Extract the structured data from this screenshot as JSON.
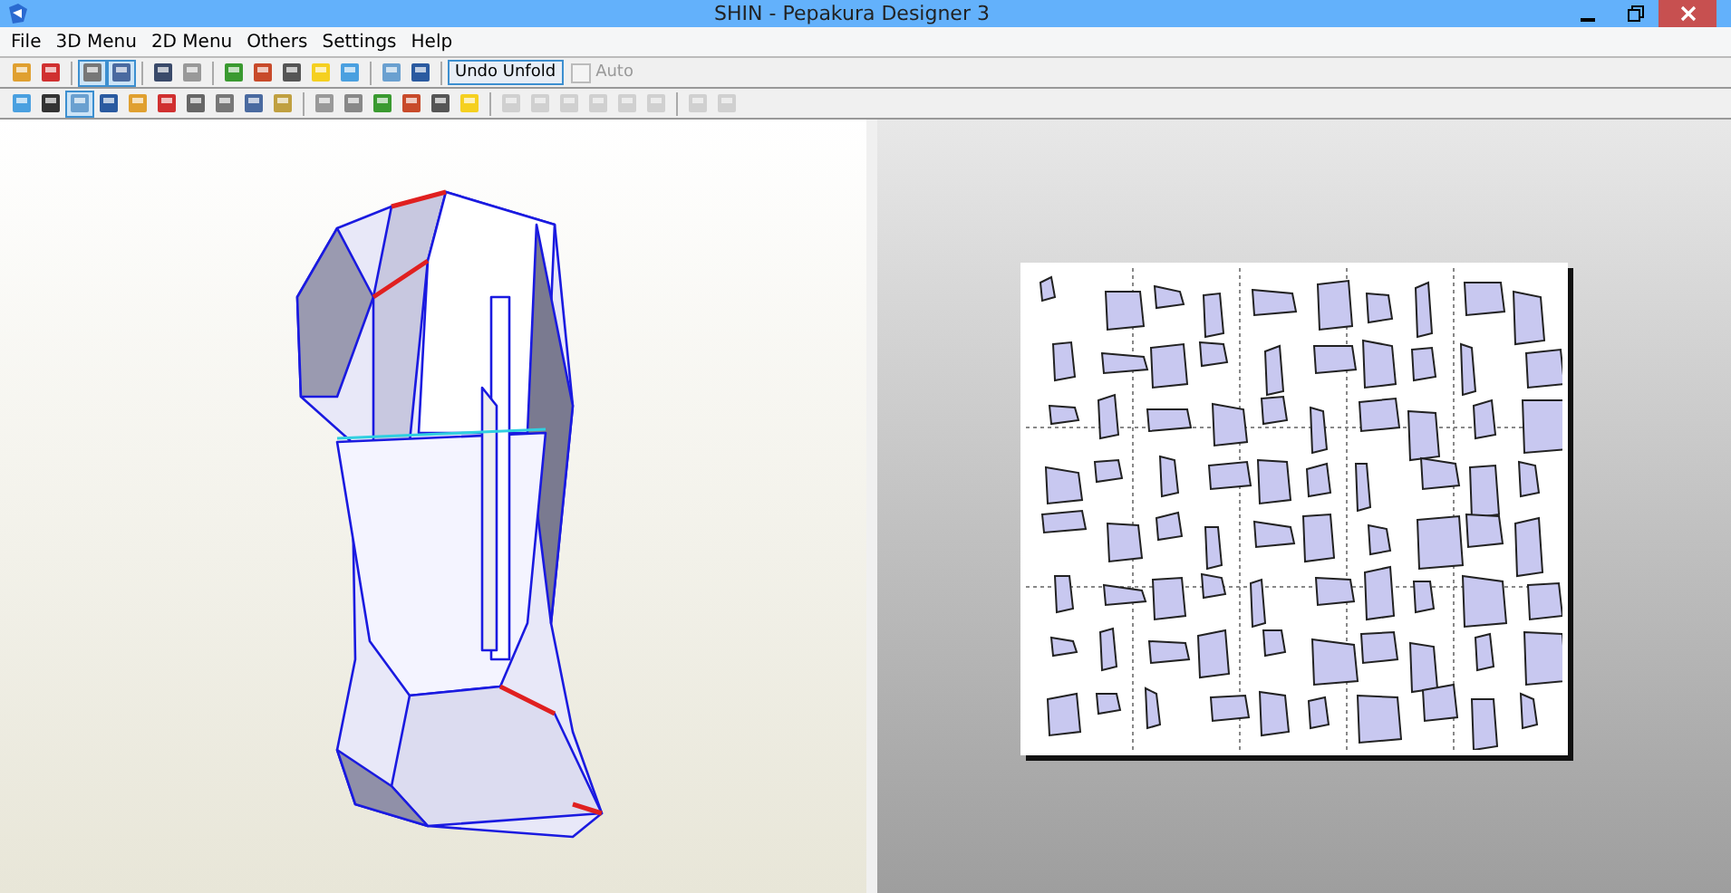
{
  "window": {
    "title": "SHIN - Pepakura Designer 3"
  },
  "menu": [
    "File",
    "3D Menu",
    "2D Menu",
    "Others",
    "Settings",
    "Help"
  ],
  "toolbars": [
    {
      "items": [
        {
          "kind": "icon",
          "selected": false,
          "disabled": false
        },
        {
          "kind": "icon",
          "selected": false,
          "disabled": false
        },
        {
          "kind": "separator"
        },
        {
          "kind": "icon",
          "selected": true,
          "disabled": false
        },
        {
          "kind": "icon",
          "selected": true,
          "disabled": false
        },
        {
          "kind": "separator"
        },
        {
          "kind": "icon",
          "selected": false,
          "disabled": false
        },
        {
          "kind": "icon",
          "selected": false,
          "disabled": false
        },
        {
          "kind": "separator"
        },
        {
          "kind": "icon",
          "selected": false,
          "disabled": false
        },
        {
          "kind": "icon",
          "selected": false,
          "disabled": false
        },
        {
          "kind": "icon",
          "selected": false,
          "disabled": false
        },
        {
          "kind": "icon",
          "selected": false,
          "disabled": false
        },
        {
          "kind": "icon",
          "selected": false,
          "disabled": false
        },
        {
          "kind": "separator"
        },
        {
          "kind": "icon",
          "selected": false,
          "disabled": false
        },
        {
          "kind": "icon",
          "selected": false,
          "disabled": false
        },
        {
          "kind": "separator"
        },
        {
          "kind": "button",
          "label": "Undo Unfold"
        },
        {
          "kind": "checkbox",
          "label": "Auto",
          "checked": false,
          "disabled": true
        }
      ]
    },
    {
      "items": [
        {
          "kind": "icon",
          "selected": false,
          "disabled": false
        },
        {
          "kind": "icon",
          "selected": false,
          "disabled": false
        },
        {
          "kind": "icon",
          "selected": true,
          "disabled": false
        },
        {
          "kind": "icon",
          "selected": false,
          "disabled": false
        },
        {
          "kind": "icon",
          "selected": false,
          "disabled": false
        },
        {
          "kind": "icon",
          "selected": false,
          "disabled": false
        },
        {
          "kind": "icon",
          "selected": false,
          "disabled": false
        },
        {
          "kind": "icon",
          "selected": false,
          "disabled": false
        },
        {
          "kind": "icon",
          "selected": false,
          "disabled": false
        },
        {
          "kind": "icon",
          "selected": false,
          "disabled": false
        },
        {
          "kind": "separator"
        },
        {
          "kind": "icon",
          "selected": false,
          "disabled": false
        },
        {
          "kind": "icon",
          "selected": false,
          "disabled": false
        },
        {
          "kind": "icon",
          "selected": false,
          "disabled": false
        },
        {
          "kind": "icon",
          "selected": false,
          "disabled": false
        },
        {
          "kind": "icon",
          "selected": false,
          "disabled": false
        },
        {
          "kind": "icon",
          "selected": false,
          "disabled": false
        },
        {
          "kind": "separator"
        },
        {
          "kind": "icon",
          "selected": false,
          "disabled": true
        },
        {
          "kind": "icon",
          "selected": false,
          "disabled": true
        },
        {
          "kind": "icon",
          "selected": false,
          "disabled": true
        },
        {
          "kind": "icon",
          "selected": false,
          "disabled": true
        },
        {
          "kind": "icon",
          "selected": false,
          "disabled": true
        },
        {
          "kind": "icon",
          "selected": false,
          "disabled": true
        },
        {
          "kind": "separator"
        },
        {
          "kind": "icon",
          "selected": false,
          "disabled": true
        },
        {
          "kind": "icon",
          "selected": false,
          "disabled": true
        }
      ]
    }
  ]
}
